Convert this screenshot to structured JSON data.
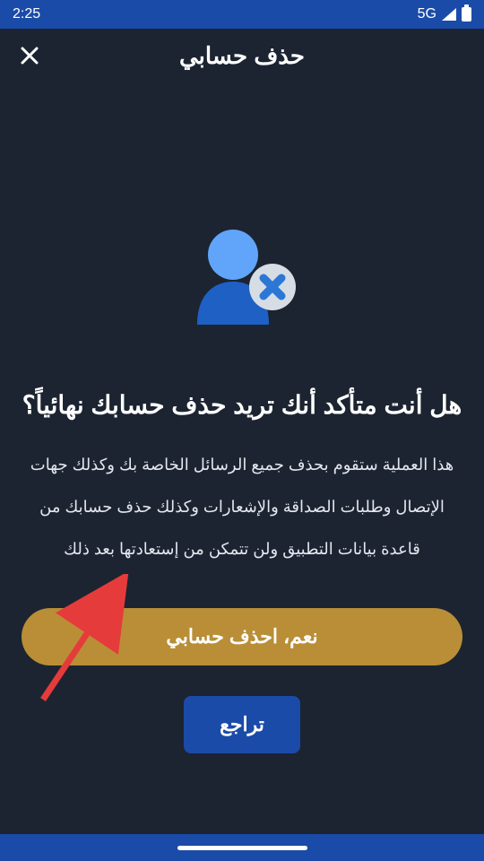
{
  "status": {
    "time": "2:25",
    "network_label": "5G"
  },
  "header": {
    "title": "حذف حسابي"
  },
  "content": {
    "heading": "هل أنت متأكد أنك تريد حذف حسابك نهائياً؟",
    "body": "هذا العملية ستقوم بحذف جميع الرسائل الخاصة بك وكذلك جهات الإتصال وطلبات الصداقة والإشعارات وكذلك حذف حسابك من قاعدة بيانات التطبيق ولن تتمكن من إستعادتها بعد ذلك"
  },
  "buttons": {
    "confirm_label": "نعم، احذف حسابي",
    "cancel_label": "تراجع"
  },
  "colors": {
    "bg": "#1c2431",
    "brand_blue": "#1b4ba8",
    "accent_gold": "#b98e37",
    "illustration_head": "#60a5fa",
    "illustration_body": "#1e60c4",
    "illustration_badge_bg": "#d7dde5",
    "illustration_badge_x": "#2c77d6"
  }
}
